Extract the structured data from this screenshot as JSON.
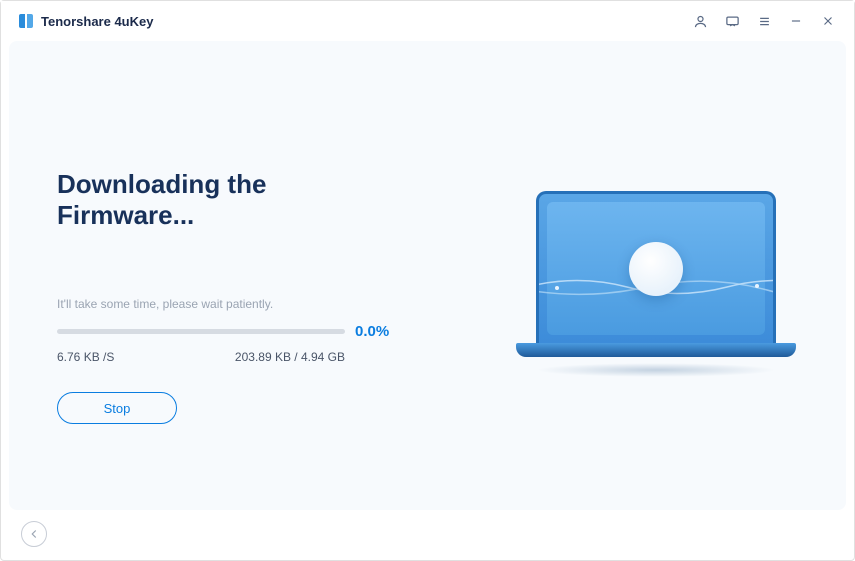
{
  "app": {
    "title": "Tenorshare 4uKey"
  },
  "titlebar_icons": {
    "user": "user-icon",
    "feedback": "feedback-icon",
    "menu": "menu-icon",
    "minimize": "minimize-icon",
    "close": "close-icon"
  },
  "main": {
    "heading": "Downloading the Firmware...",
    "wait_message": "It'll take some time, please wait patiently.",
    "progress_percent": "0.0%",
    "download_speed": "6.76 KB /S",
    "download_size": "203.89 KB / 4.94 GB",
    "stop_label": "Stop"
  },
  "footer": {
    "back_label": "Back"
  },
  "colors": {
    "accent": "#0a7de0",
    "heading": "#18315a",
    "muted": "#9aa4b2"
  }
}
